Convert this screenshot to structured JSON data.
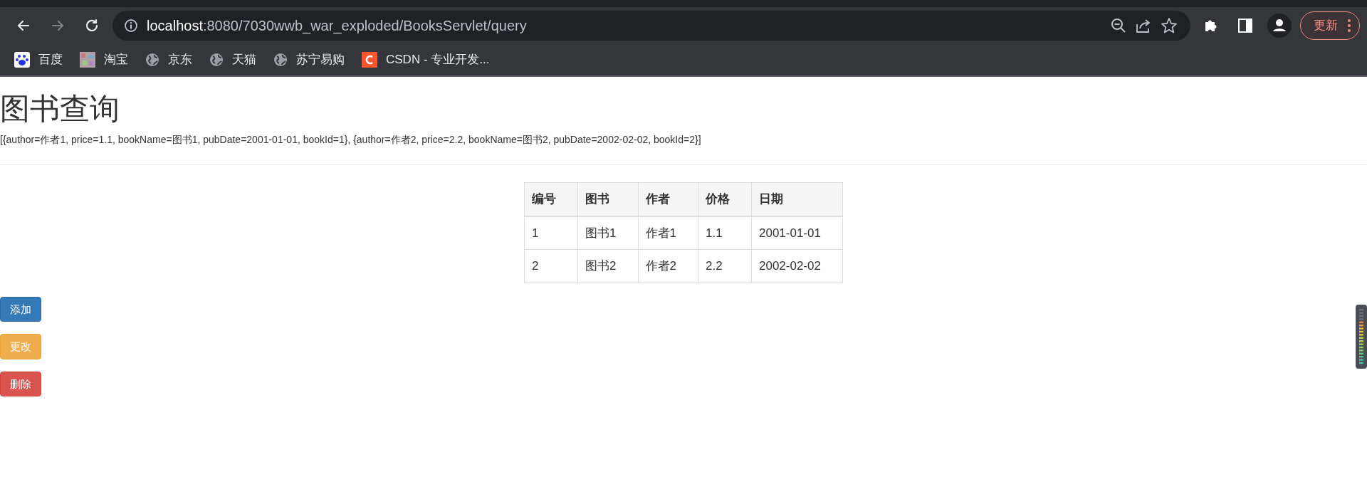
{
  "browser": {
    "nav_buttons": [
      {
        "kind": "back",
        "disabled": false
      },
      {
        "kind": "forward",
        "disabled": true
      },
      {
        "kind": "reload",
        "disabled": false
      }
    ],
    "url_host": "localhost",
    "url_path": ":8080/7030wwb_war_exploded/BooksServlet/query",
    "update_button": "更新",
    "bookmarks": [
      {
        "label": "百度",
        "kind": "paw"
      },
      {
        "label": "淘宝",
        "kind": "mosaic"
      },
      {
        "label": "京东",
        "kind": "globe"
      },
      {
        "label": "天猫",
        "kind": "globe"
      },
      {
        "label": "苏宁易购",
        "kind": "globe"
      },
      {
        "label": "CSDN - 专业开发...",
        "kind": "letter"
      }
    ]
  },
  "page": {
    "title": "图书查询",
    "raw_data": "[{author=作者1, price=1.1, bookName=图书1, pubDate=2001-01-01, bookId=1}, {author=作者2, price=2.2, bookName=图书2, pubDate=2002-02-02, bookId=2}]",
    "table": {
      "columns": [
        "编号",
        "图书",
        "作者",
        "价格",
        "日期"
      ],
      "rows": [
        [
          "1",
          "图书1",
          "作者1",
          "1.1",
          "2001-01-01"
        ],
        [
          "2",
          "图书2",
          "作者2",
          "2.2",
          "2002-02-02"
        ]
      ]
    },
    "buttons": [
      {
        "label": "添加",
        "kind": "primary"
      },
      {
        "label": "更改",
        "kind": "warning"
      },
      {
        "label": "删除",
        "kind": "danger"
      }
    ]
  }
}
